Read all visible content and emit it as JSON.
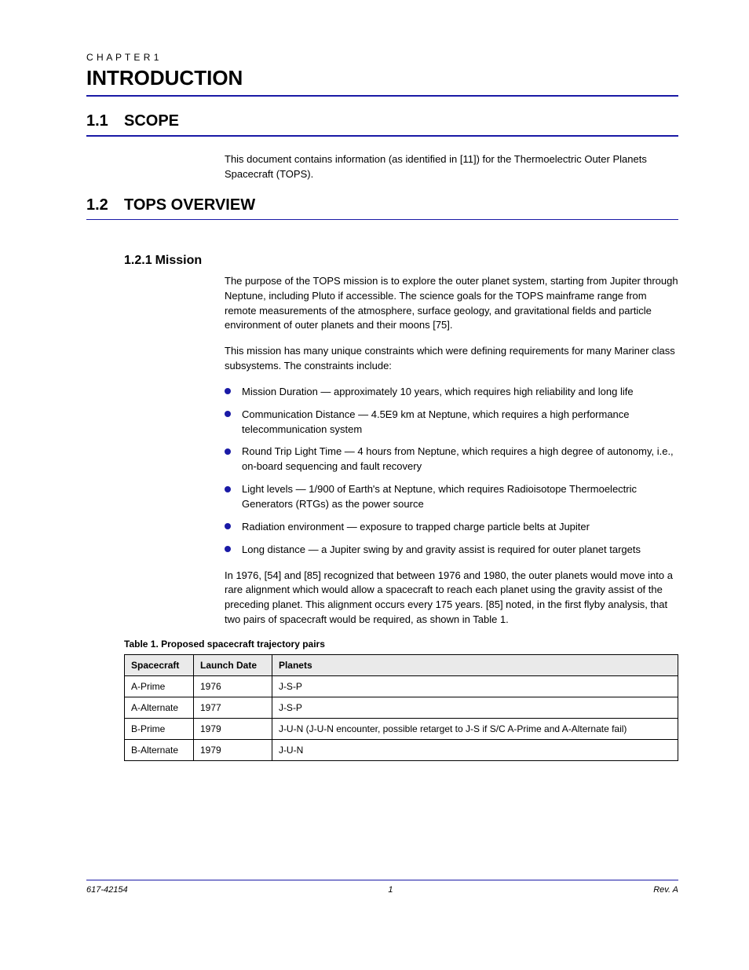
{
  "chapter": {
    "label": "C H A P T E R  1",
    "title": "INTRODUCTION"
  },
  "section1": {
    "number": "1.1",
    "title": "SCOPE",
    "p1": "This document contains information (as identified in [11]) for the Thermoelectric Outer Planets Spacecraft (TOPS)."
  },
  "section2": {
    "number": "1.2",
    "title": "TOPS OVERVIEW",
    "subsection": "Mission",
    "p1": "The purpose of the TOPS mission is to explore the outer planet system, starting from Jupiter through Neptune, including Pluto if accessible. The science goals for the TOPS mainframe range from remote measurements of the atmosphere, surface geology, and gravitational fields and particle environment of outer planets and their moons [75].",
    "p2": "This mission has many unique constraints which were defining requirements for many Mariner class subsystems. The constraints include:",
    "bullets": [
      "Mission Duration — approximately 10 years, which requires high reliability and long life",
      "Communication Distance — 4.5E9 km at Neptune, which requires a high performance telecommunication system",
      "Round Trip Light Time — 4 hours from Neptune, which requires a high degree of autonomy, i.e., on-board sequencing and fault recovery",
      "Light levels — 1/900 of Earth's at Neptune, which requires Radioisotope Thermoelectric Generators (RTGs) as the power source",
      "Radiation environment — exposure to trapped charge particle belts at Jupiter",
      "Long distance — a Jupiter swing by and gravity assist is required for outer planet targets"
    ],
    "p3": "In 1976, [54] and [85] recognized that between 1976 and 1980, the outer planets would move into a rare alignment which would allow a spacecraft to reach each planet using the gravity assist of the preceding planet. This alignment occurs every 175 years. [85] noted, in the first flyby analysis, that two pairs of spacecraft would be required, as shown in Table 1."
  },
  "table": {
    "title": "Table 1. Proposed spacecraft trajectory pairs",
    "headers": [
      "Spacecraft",
      "Launch Date",
      "Planets"
    ],
    "rows": [
      [
        "A-Prime",
        "1976",
        "J-S-P"
      ],
      [
        "A-Alternate",
        "1977",
        "J-S-P"
      ],
      [
        "B-Prime",
        "1979",
        "J-U-N (J-U-N encounter, possible retarget to J-S if S/C A-Prime and A-Alternate fail)"
      ],
      [
        "B-Alternate",
        "1979",
        "J-U-N"
      ]
    ]
  },
  "footer": {
    "left": "617-42154",
    "center": "1",
    "right": "Rev. A"
  }
}
